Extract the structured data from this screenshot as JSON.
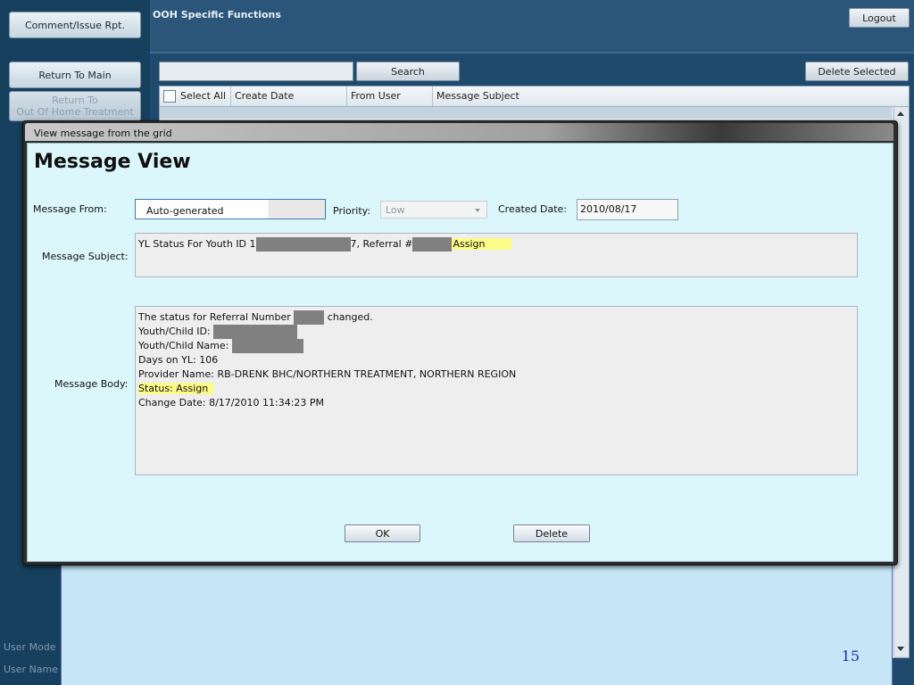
{
  "sidebar": {
    "comment_btn": "Comment/Issue Rpt.",
    "return_main_btn": "Return To Main",
    "return_ooh_btn": "Return To\nOut Of Home Treatment",
    "user_mode_label": "User Mode",
    "user_name_label": "User Name"
  },
  "header": {
    "title": "OOH Specific Functions",
    "logout": "Logout"
  },
  "grid": {
    "search_value": "",
    "search_btn": "Search",
    "delete_selected_btn": "Delete Selected",
    "columns": [
      "Select All",
      "Create Date",
      "From User",
      "Message Subject"
    ]
  },
  "modal": {
    "window_title": "View message from the grid",
    "heading": "Message View",
    "from_label": "Message From:",
    "from_value": "Auto-generated",
    "priority_label": "Priority:",
    "priority_value": "Low",
    "created_label": "Created Date:",
    "created_value": "2010/08/17",
    "subject_label": "Message Subject:",
    "subject_prefix": "YL Status For Youth ID 1",
    "subject_mid": "7, Referral #",
    "subject_status": "Assign",
    "body_label": "Message Body:",
    "body_line1_a": "The status for Referral Number",
    "body_line1_b": "changed.",
    "body_youth_id": "Youth/Child ID:",
    "body_youth_name": "Youth/Child Name:",
    "body_days": "Days on YL:  106",
    "body_provider": "Provider Name:  RB-DRENK BHC/NORTHERN TREATMENT, NORTHERN REGION",
    "body_status": "Status:  Assign",
    "body_change_date": "Change Date:  8/17/2010 11:34:23 PM",
    "ok_btn": "OK",
    "delete_btn": "Delete"
  },
  "slide": {
    "page_number": "15"
  }
}
